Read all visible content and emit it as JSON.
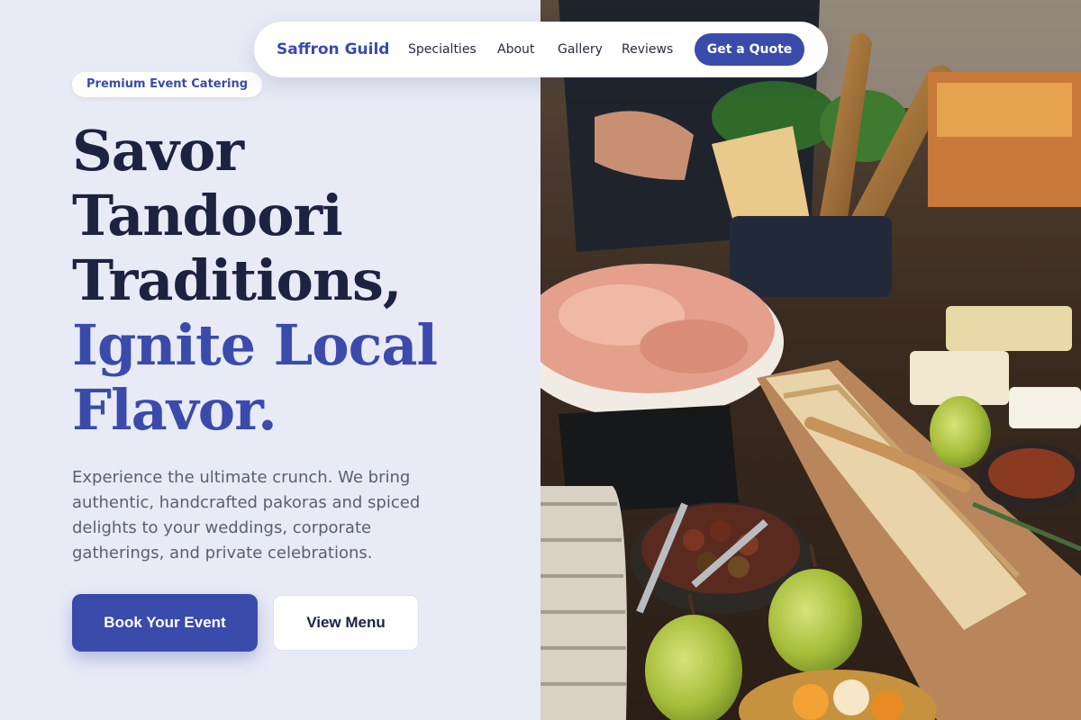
{
  "nav": {
    "brand": "Saffron Guild",
    "links": [
      "Specialties",
      "About",
      "Gallery",
      "Reviews"
    ],
    "cta": "Get a Quote"
  },
  "hero": {
    "badge": "Premium Event Catering",
    "headline_lines": [
      "Savor",
      "Tandoori",
      "Traditions,"
    ],
    "headline_accent_lines": [
      "Ignite Local",
      "Flavor."
    ],
    "description": "Experience the ultimate crunch. We bring authentic, handcrafted pakoras and spiced delights to your weddings, corporate gatherings, and private celebrations.",
    "primary_button": "Book Your Event",
    "secondary_button": "View Menu"
  },
  "colors": {
    "accent": "#3a4bab",
    "dark_text": "#1c2340",
    "background": "#e8eaf6"
  }
}
